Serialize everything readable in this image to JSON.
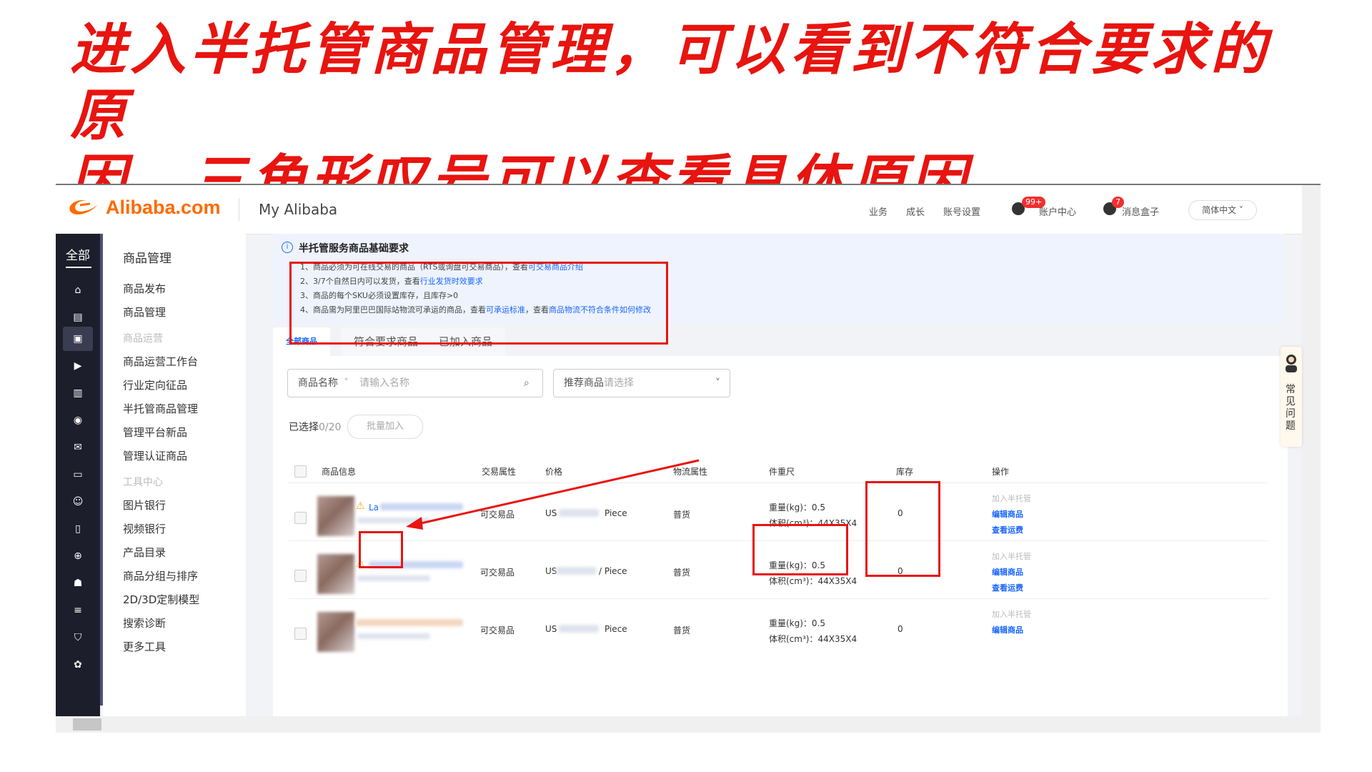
{
  "caption": {
    "line1": "进入半托管商品管理，可以看到不符合要求的原",
    "line2": "因，三角形叹号可以查看具体原因"
  },
  "header": {
    "logo": "Alibaba.com",
    "title": "My Alibaba",
    "nav": [
      "业务",
      "成长",
      "账号设置"
    ],
    "account_center": "账户中心",
    "account_badge": "99+",
    "message_box": "消息盒子",
    "message_badge": "7",
    "language": "简体中文"
  },
  "rail": {
    "all_label": "全部",
    "icons": [
      "home-icon",
      "store-icon",
      "product-icon",
      "video-icon",
      "chart-icon",
      "broadcast-icon",
      "ticket-icon",
      "message-icon",
      "users-icon",
      "clipboard-icon",
      "globe-icon",
      "robot-icon",
      "database-icon",
      "shield-icon",
      "leaf-icon"
    ]
  },
  "menu": {
    "heading": "商品管理",
    "items": [
      {
        "label": "商品发布",
        "type": "item"
      },
      {
        "label": "商品管理",
        "type": "item"
      },
      {
        "label": "商品运营",
        "type": "group"
      },
      {
        "label": "商品运营工作台",
        "type": "item"
      },
      {
        "label": "行业定向征品",
        "type": "item"
      },
      {
        "label": "半托管商品管理",
        "type": "item"
      },
      {
        "label": "管理平台新品",
        "type": "item"
      },
      {
        "label": "管理认证商品",
        "type": "item"
      },
      {
        "label": "工具中心",
        "type": "group"
      },
      {
        "label": "图片银行",
        "type": "item"
      },
      {
        "label": "视频银行",
        "type": "item"
      },
      {
        "label": "产品目录",
        "type": "item"
      },
      {
        "label": "商品分组与排序",
        "type": "item"
      },
      {
        "label": "2D/3D定制模型",
        "type": "item"
      },
      {
        "label": "搜索诊断",
        "type": "item"
      },
      {
        "label": "更多工具",
        "type": "item"
      }
    ]
  },
  "notice": {
    "title": "半托管服务商品基础要求",
    "line1_text": "1、商品必须为可在线交易的商品（RTS或询盘可交易商品），查看",
    "line1_link": "可交易商品介绍",
    "line2_text": "2、3/7个自然日内可以发货，查看",
    "line2_link": "行业发货时效要求",
    "line3_text": "3、商品的每个SKU必须设置库存，且库存>0",
    "line4_text": "4、商品需为阿里巴巴国际站物流可承运的商品，查看",
    "line4_link1": "可承运标准",
    "line4_mid": "，查看",
    "line4_link2": "商品物流不符合条件如何修改"
  },
  "tabs": [
    "全部商品",
    "符合要求商品",
    "已加入商品"
  ],
  "filters": {
    "name_label": "商品名称",
    "name_placeholder": "请输入名称",
    "recommend_label": "推荐商品",
    "recommend_placeholder": "请选择"
  },
  "selection": {
    "prefix": "已选择",
    "count": "0/20",
    "bulk_button": "批量加入"
  },
  "table": {
    "headers": [
      "商品信息",
      "交易属性",
      "价格",
      "物流属性",
      "件重尺",
      "库存",
      "操作"
    ],
    "rows": [
      {
        "title_fragment": "La",
        "trade": "可交易品",
        "price_prefix": "US",
        "price_unit": "Piece",
        "logistics": "普货",
        "weight": "重量(kg)：0.5",
        "volume": "体积(cm³)：44X35X4",
        "stock": "0",
        "actions": [
          "加入半托管",
          "编辑商品",
          "查看运费"
        ]
      },
      {
        "title_fragment": "",
        "trade": "可交易品",
        "price_prefix": "US",
        "price_unit": "/ Piece",
        "logistics": "普货",
        "weight": "重量(kg)：0.5",
        "volume": "体积(cm³)：44X35X4",
        "stock": "0",
        "actions": [
          "加入半托管",
          "编辑商品",
          "查看运费"
        ]
      },
      {
        "title_fragment": "",
        "trade": "可交易品",
        "price_prefix": "US",
        "price_unit": "Piece",
        "logistics": "普货",
        "weight": "重量(kg)：0.5",
        "volume": "体积(cm³)：44X35X4",
        "stock": "0",
        "actions": [
          "加入半托管",
          "编辑商品"
        ]
      }
    ]
  },
  "side_help": "常见问题",
  "colors": {
    "annotation_red": "#e8140f",
    "brand_orange": "#ff6a00",
    "link_blue": "#1a66ff",
    "rail_bg": "#1c1e2b"
  }
}
